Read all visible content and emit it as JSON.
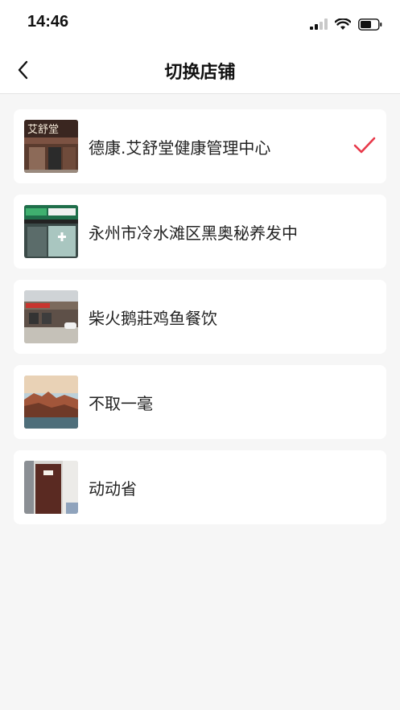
{
  "status_bar": {
    "time": "14:46"
  },
  "nav": {
    "title": "切换店铺",
    "back_icon": "chevron-left-icon"
  },
  "stores": [
    {
      "name": "德康.艾舒堂健康管理中心",
      "selected": true,
      "thumb_text": "艾舒堂"
    },
    {
      "name": "永州市冷水滩区黑奥秘养发中",
      "selected": false
    },
    {
      "name": "柴火鹅莊鸡鱼餐饮",
      "selected": false
    },
    {
      "name": "不取一毫",
      "selected": false
    },
    {
      "name": "动动省",
      "selected": false
    }
  ],
  "colors": {
    "accent": "#e8394a",
    "background": "#f6f6f6",
    "card": "#ffffff"
  }
}
